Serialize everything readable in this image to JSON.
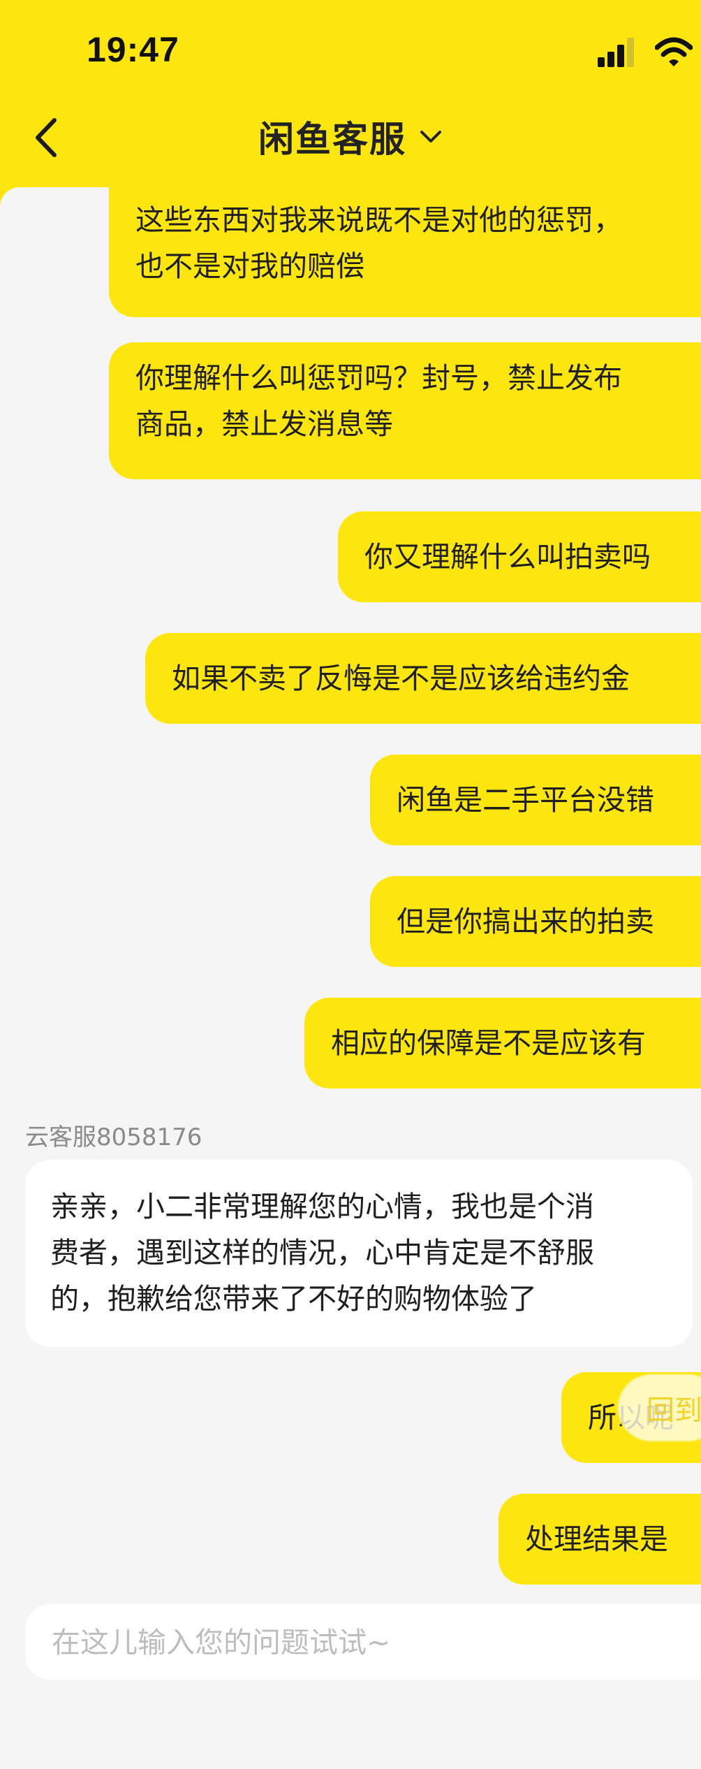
{
  "status_bar": {
    "time": "19:47"
  },
  "header": {
    "title": "闲鱼客服"
  },
  "messages_out": [
    {
      "lines": [
        "这些东西对我来说既不是对他的惩罚，",
        "也不是对我的赔偿"
      ]
    },
    {
      "lines": [
        "你理解什么叫惩罚吗？封号，禁止发布",
        "商品，禁止发消息等"
      ]
    },
    {
      "text": "你又理解什么叫拍卖吗"
    },
    {
      "text": "如果不卖了反悔是不是应该给违约金"
    },
    {
      "text": "闲鱼是二手平台没错"
    },
    {
      "text": "但是你搞出来的拍卖"
    },
    {
      "text": "相应的保障是不是应该有"
    },
    {
      "text": "所以呢"
    },
    {
      "text": "处理结果是"
    }
  ],
  "incoming": {
    "sender": "云客服8058176",
    "lines": [
      "亲亲，小二非常理解您的心情，我也是个消",
      "费者，遇到这样的情况，心中肯定是不舒服",
      "的，抱歉给您带来了不好的购物体验了"
    ]
  },
  "float_button": {
    "label": "回到"
  },
  "composer": {
    "placeholder": "在这儿输入您的问题试试~"
  },
  "colors": {
    "brand_yellow": "#fde60e",
    "background": "#f5f5f5",
    "incoming_bubble": "#ffffff"
  },
  "icons": {
    "back": "chevron-left-icon",
    "title_dropdown": "chevron-down-icon",
    "signal": "cellular-signal-icon",
    "wifi": "wifi-icon"
  }
}
